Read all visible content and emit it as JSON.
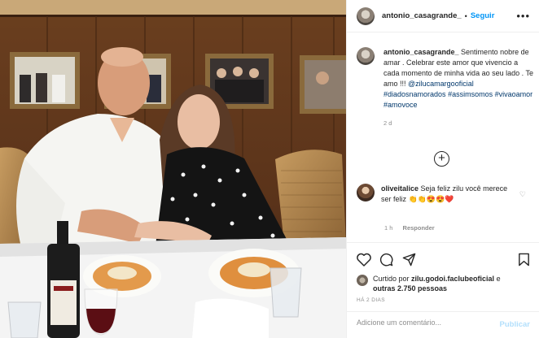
{
  "post": {
    "username": "antonio_casagrande_",
    "follow_label": "Seguir",
    "separator": "•",
    "more_label": "•••"
  },
  "caption": {
    "username": "antonio_casagrande_",
    "line1": "Sentimento nobre de amar . Celebrar este amor que vivencio a cada momento de minha vida ao seu lado . Te amo !!!",
    "mention": "@zilucamargooficial",
    "hashtags": [
      "#diadosnamorados",
      "#assimsomos",
      "#vivaoamor",
      "#amovoce"
    ],
    "age": "2 d"
  },
  "load_more": "+",
  "comment": {
    "username": "oliveitalice",
    "text": "Seja feliz zilu você merece ser feliz 👏👏😍😍❤️",
    "second_line_emoji": "❤️",
    "age": "1 h",
    "reply_label": "Responder",
    "heart_icon": "♡"
  },
  "likes": {
    "prefix": "Curtido por",
    "user": "zilu.godoi.faclubeoficial",
    "middle": "e",
    "others": "outras 2.750 pessoas"
  },
  "post_date": "HÁ 2 DIAS",
  "add_comment": {
    "placeholder": "Adicione um comentário...",
    "publish_label": "Publicar"
  },
  "colors": {
    "link": "#00376b",
    "follow": "#0095f6",
    "publish_disabled": "#b2dffc",
    "secondary": "#8e8e8e"
  }
}
